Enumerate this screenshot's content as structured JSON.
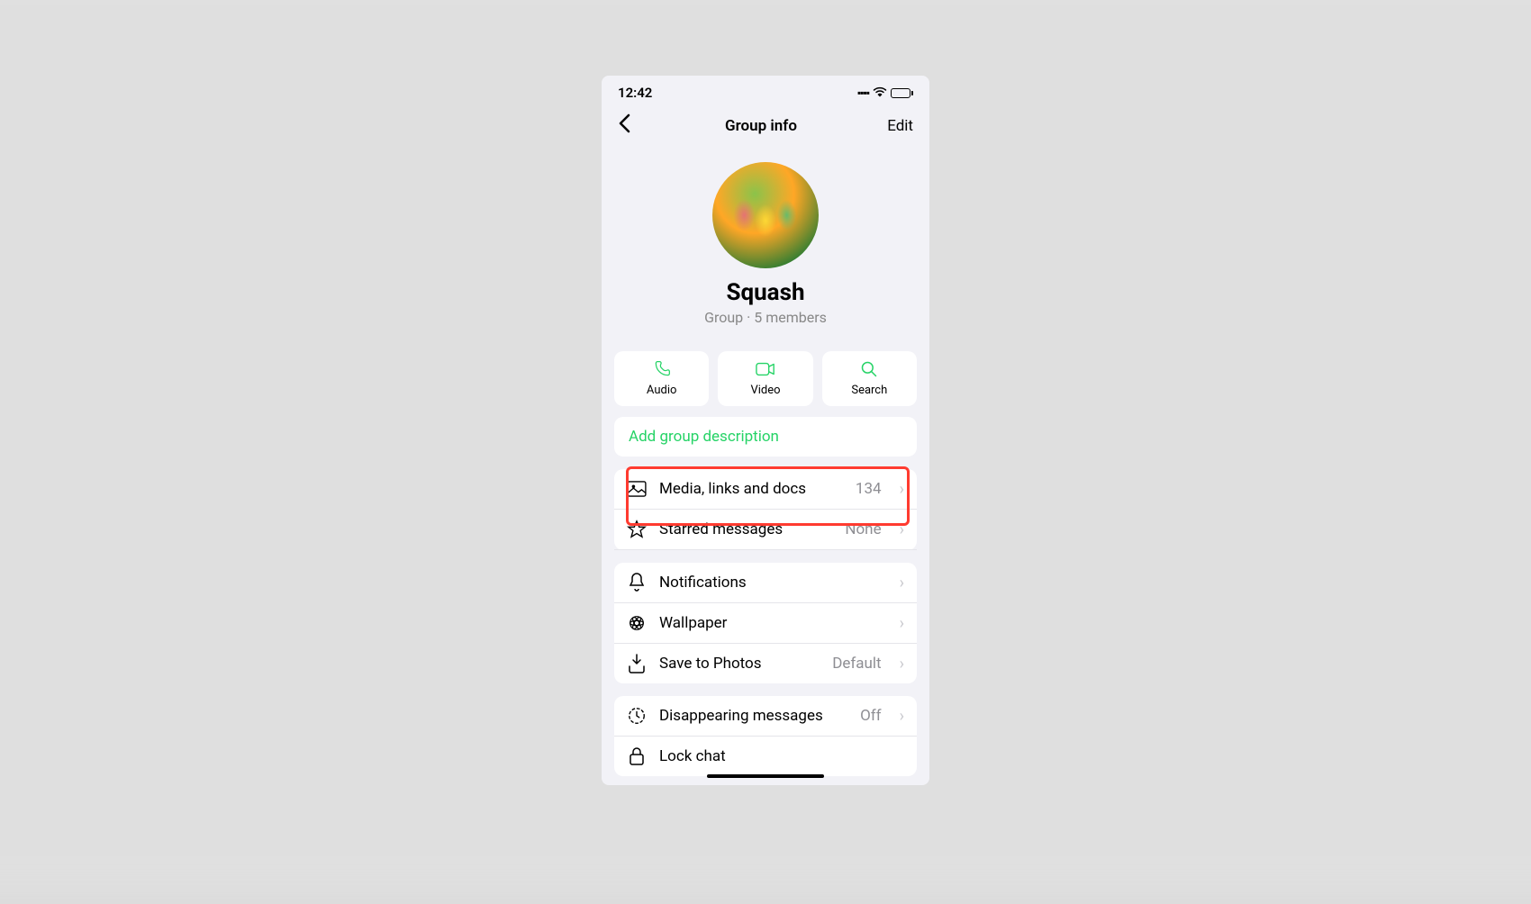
{
  "status": {
    "time": "12:42",
    "signal_icon": "signal-icon",
    "wifi_icon": "wifi-icon",
    "battery_icon": "battery-icon"
  },
  "nav": {
    "back": "‹",
    "title": "Group info",
    "edit": "Edit"
  },
  "group": {
    "name": "Squash",
    "meta": "Group · 5 members"
  },
  "actions": {
    "audio": "Audio",
    "video": "Video",
    "search": "Search"
  },
  "description": {
    "add": "Add group description"
  },
  "rows": {
    "media": {
      "label": "Media, links and docs",
      "value": "134"
    },
    "starred": {
      "label": "Starred messages",
      "value": "None"
    },
    "notifications": {
      "label": "Notifications",
      "value": ""
    },
    "wallpaper": {
      "label": "Wallpaper",
      "value": ""
    },
    "save_photos": {
      "label": "Save to Photos",
      "value": "Default"
    },
    "disappearing": {
      "label": "Disappearing messages",
      "value": "Off"
    },
    "lock_chat": {
      "label": "Lock chat",
      "value": ""
    }
  },
  "highlight": {
    "target": "media"
  }
}
